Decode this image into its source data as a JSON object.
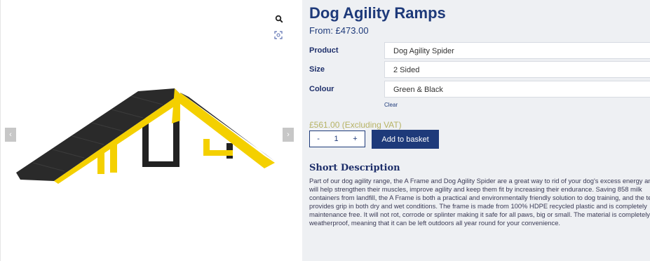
{
  "gallery": {
    "zoom_icon": "search-icon",
    "scan_icon": "scan-icon",
    "prev_label": "‹",
    "next_label": "›"
  },
  "product": {
    "title": "Dog Agility Ramps",
    "from_price": "From: £473.00",
    "options": {
      "product_label": "Product",
      "product_value": "Dog Agility Spider",
      "size_label": "Size",
      "size_value": "2 Sided",
      "colour_label": "Colour",
      "colour_value": "Green & Black",
      "clear_label": "Clear"
    },
    "price": "£561.00 (Excluding VAT)",
    "quantity": {
      "minus": "-",
      "value": "1",
      "plus": "+"
    },
    "add_to_basket": "Add to basket",
    "short_description_title": "Short Description",
    "short_description": "Part of our dog agility range, the A Frame and Dog Agility Spider are a great way to rid of your dog's excess energy and it will help strengthen their muscles, improve agility and keep them fit by increasing their endurance. Saving 858 milk containers from landfill, the A Frame is both a practical and environmentally friendly solution to dog training, and the texture provides grip in both dry and wet conditions. The frame is made from 100% HDPE recycled plastic and is completely maintenance free. It will not rot, corrode or splinter making it safe for all paws, big or small. The material is completely weatherproof, meaning that it can be left outdoors all year round for your convenience."
  },
  "colors": {
    "brand": "#1e3a7a",
    "price": "#b7b365",
    "panel_bg": "#eef0f3"
  }
}
